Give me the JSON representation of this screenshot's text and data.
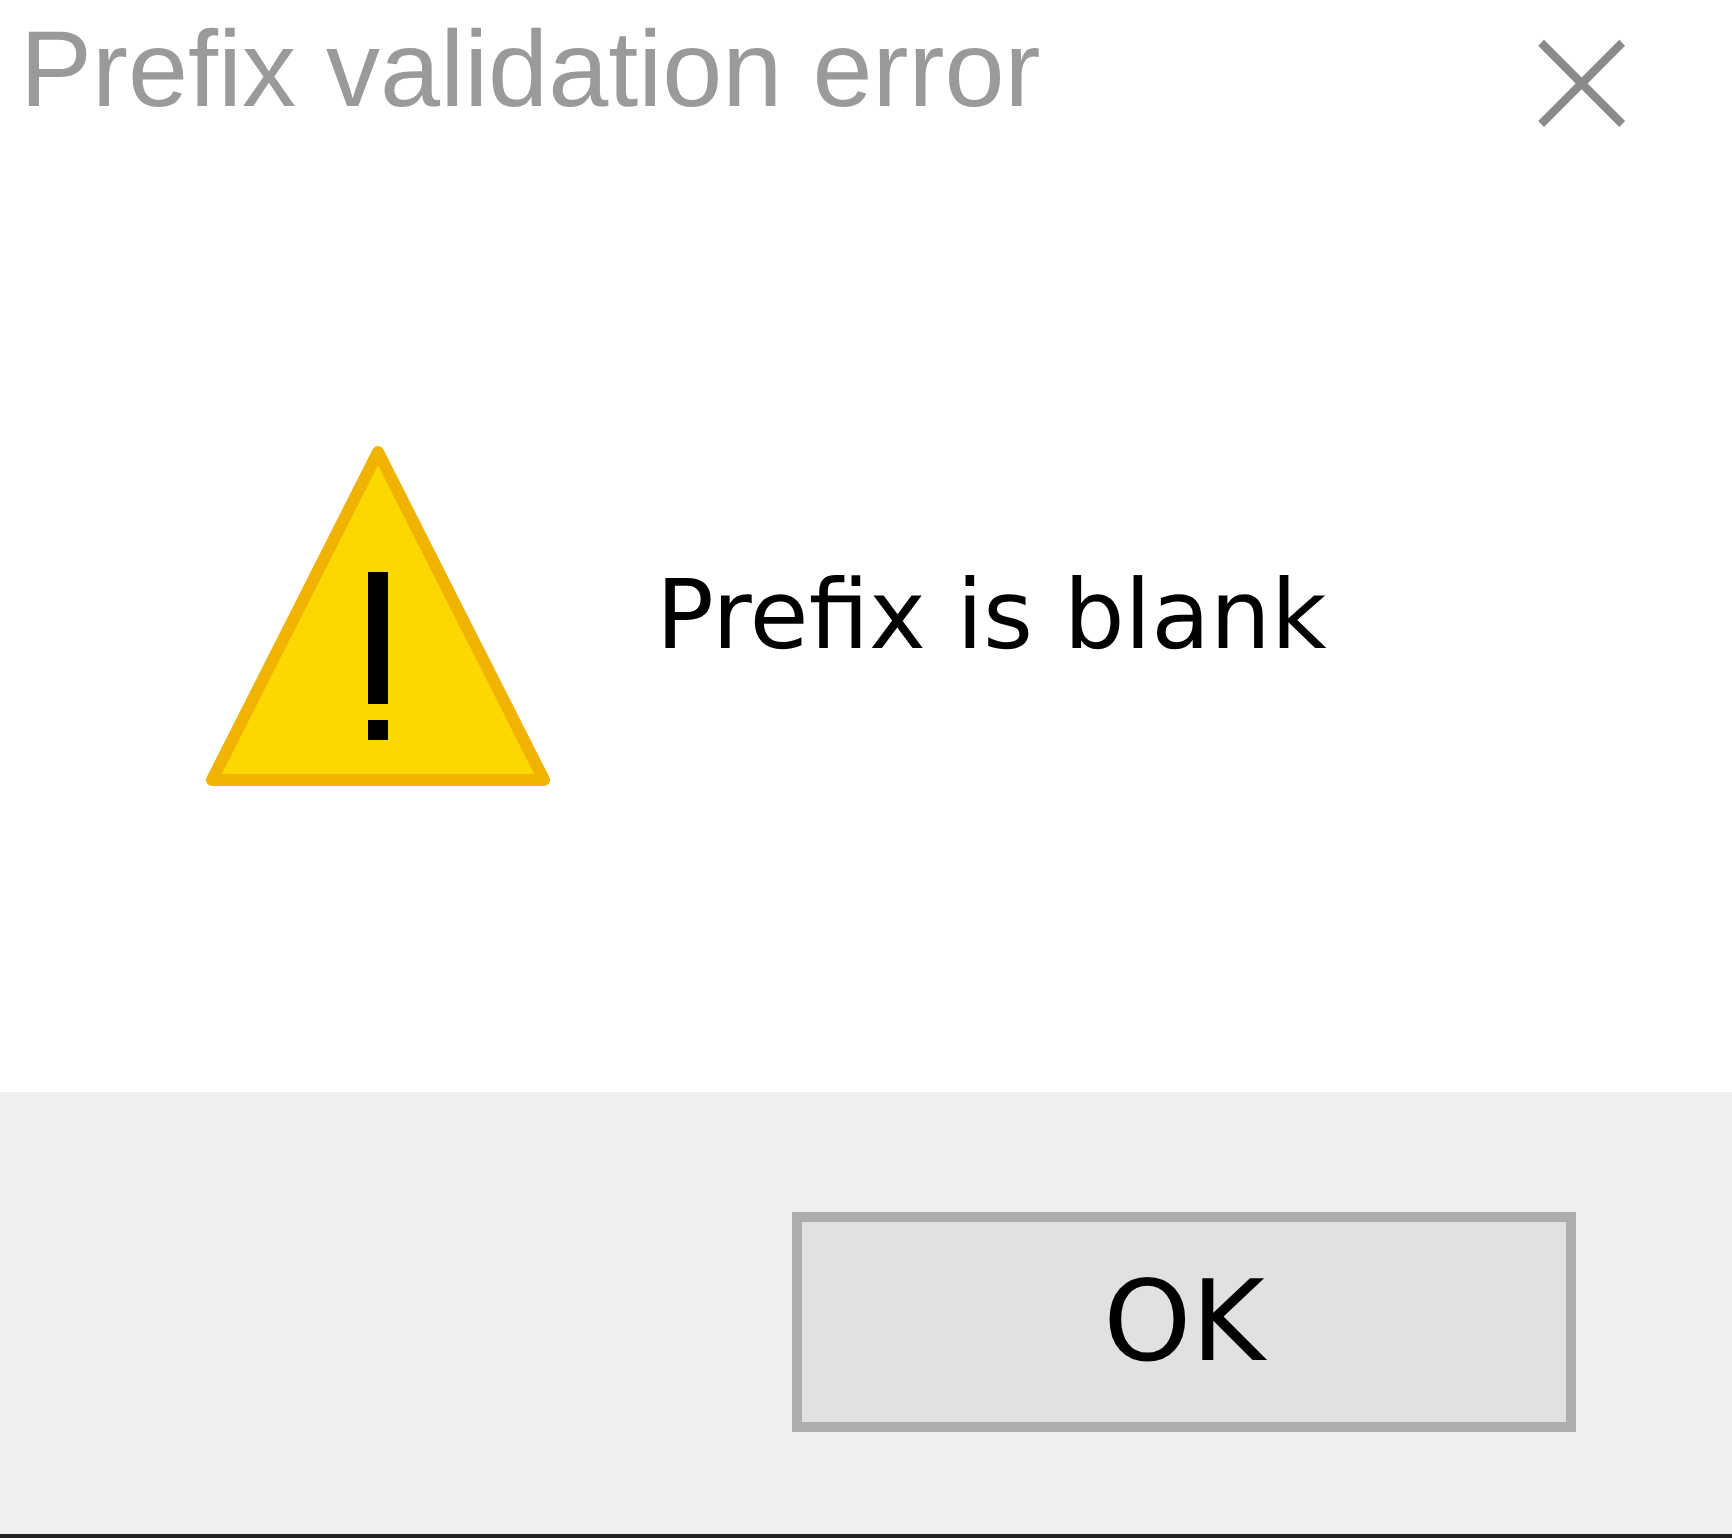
{
  "window": {
    "title": "Prefix validation error",
    "close": "×"
  },
  "message": {
    "kind": "warning",
    "text": "Prefix is blank"
  },
  "buttons": [
    {
      "label": "OK",
      "default": true
    }
  ]
}
